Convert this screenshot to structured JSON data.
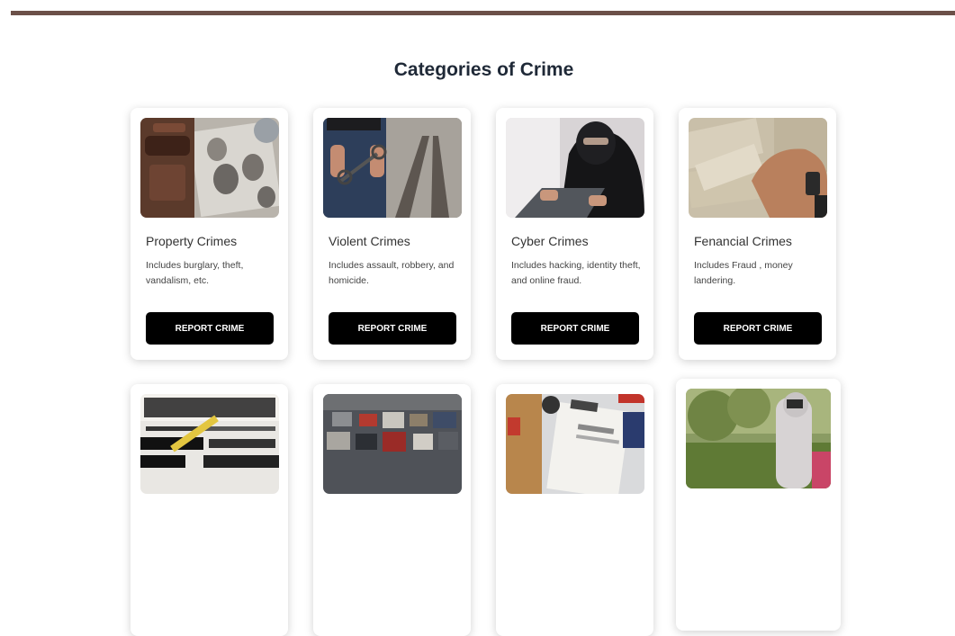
{
  "section": {
    "title": "Categories of Crime"
  },
  "categories": [
    {
      "title": "Property Crimes",
      "description": "Includes burglary, theft, vandalism, etc.",
      "button_label": "REPORT CRIME",
      "image": "gavel-fingerprint-image"
    },
    {
      "title": "Violent Crimes",
      "description": "Includes assault, robbery, and homicide.",
      "button_label": "REPORT CRIME",
      "image": "handcuffs-railway-image"
    },
    {
      "title": "Cyber Crimes",
      "description": "Includes hacking, identity theft, and online fraud.",
      "button_label": "REPORT CRIME",
      "image": "masked-hacker-laptop-image"
    },
    {
      "title": "Fenancial Crimes",
      "description": "Includes Fraud , money landering.",
      "button_label": "REPORT CRIME",
      "image": "cash-bundle-hand-image"
    }
  ],
  "second_row": [
    {
      "image": "drug-threat-newspaper-image"
    },
    {
      "image": "traffic-jam-image"
    },
    {
      "image": "evidence-clipboard-image"
    },
    {
      "image": "forest-person-image"
    }
  ],
  "colors": {
    "top_bar": "#6b5048",
    "title": "#1f2937",
    "button_bg": "#000000",
    "button_text": "#ffffff"
  }
}
